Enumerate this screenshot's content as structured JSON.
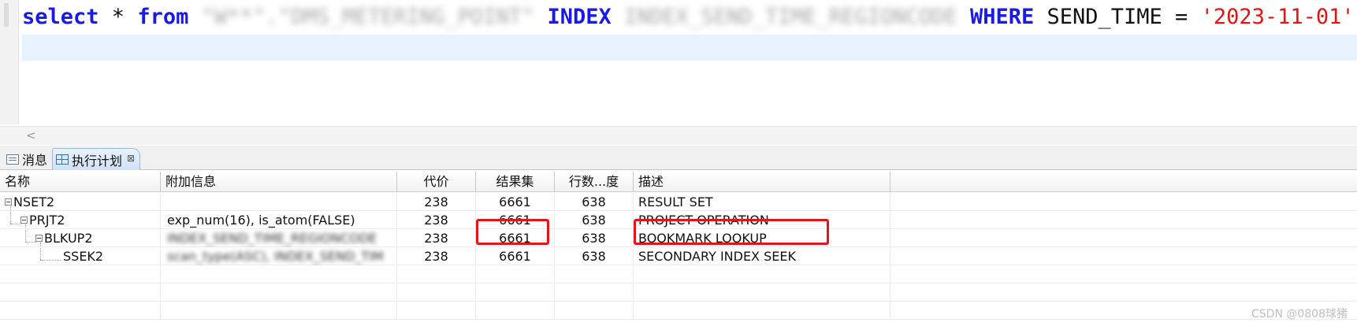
{
  "editor": {
    "keyword_select": "select",
    "star": " * ",
    "keyword_from": "from",
    "obscured_table": " \"W**\".\"DMS_METERING_POINT\" ",
    "keyword_index": "INDEX",
    "obscured_index": " INDEX_SEND_TIME_REGIONCODE ",
    "keyword_where": "WHERE",
    "condition": " SEND_TIME = ",
    "literal": "'2023-11-01'",
    "semicolon": ";"
  },
  "scroll_left_glyph": "<",
  "tabs": {
    "messages": "消息",
    "plan": "执行计划",
    "plan_close": "⊠"
  },
  "grid": {
    "columns": [
      "名称",
      "附加信息",
      "代价",
      "结果集",
      "行数...度",
      "描述"
    ],
    "rows": [
      {
        "name": "NSET2",
        "info": "",
        "cost": "238",
        "result": "6661",
        "rows": "638",
        "desc": "RESULT SET"
      },
      {
        "name": "PRJT2",
        "info": "exp_num(16), is_atom(FALSE)",
        "cost": "238",
        "result": "6661",
        "rows": "638",
        "desc": "PROJECT OPERATION"
      },
      {
        "name": "BLKUP2",
        "info": "INDEX_SEND_TIME_REGIONCODE",
        "cost": "238",
        "result": "6661",
        "rows": "638",
        "desc": "BOOKMARK LOOKUP"
      },
      {
        "name": "SSEK2",
        "info": "scan_type(ASC), INDEX_SEND_TIM",
        "cost": "238",
        "result": "6661",
        "rows": "638",
        "desc": "SECONDARY INDEX SEEK"
      }
    ]
  },
  "colors": {
    "keyword": "#1a1ae8",
    "string_literal": "#e01515",
    "highlight_box": "#e3141c",
    "current_line": "#e8f2fe"
  },
  "watermark": "CSDN @0808球猪"
}
